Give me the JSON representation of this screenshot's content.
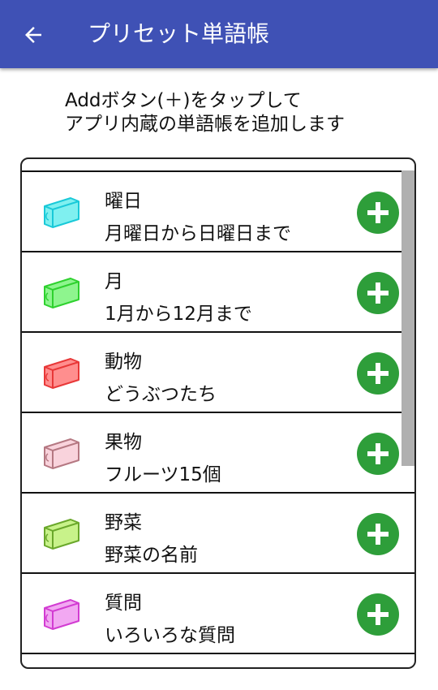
{
  "appbar": {
    "title": "プリセット単語帳",
    "back_icon": "arrow-left-icon",
    "color": "#3f51b5"
  },
  "instructions": {
    "line1": "Addボタン(＋)をタップして",
    "line2": "アプリ内蔵の単語帳を追加します"
  },
  "accent": {
    "add_button": "#2e9e3a"
  },
  "books": [
    {
      "title": "曜日",
      "subtitle": "月曜日から日曜日まで",
      "icon": "cyan-book-icon",
      "fill": "#7ff0f0",
      "stroke": "#19c9d8"
    },
    {
      "title": "月",
      "subtitle": "1月から12月まで",
      "icon": "green-book-icon",
      "fill": "#8ef58e",
      "stroke": "#2ed12e"
    },
    {
      "title": "動物",
      "subtitle": "どうぶつたち",
      "icon": "red-book-icon",
      "fill": "#ff8e8e",
      "stroke": "#e83838"
    },
    {
      "title": "果物",
      "subtitle": "フルーツ15個",
      "icon": "pink-book-icon",
      "fill": "#f9d3dc",
      "stroke": "#b57882"
    },
    {
      "title": "野菜",
      "subtitle": "野菜の名前",
      "icon": "lime-book-icon",
      "fill": "#c8f28a",
      "stroke": "#6aa82b"
    },
    {
      "title": "質問",
      "subtitle": "いろいろな質問",
      "icon": "magenta-book-icon",
      "fill": "#f2a8f2",
      "stroke": "#d23cd2"
    }
  ]
}
